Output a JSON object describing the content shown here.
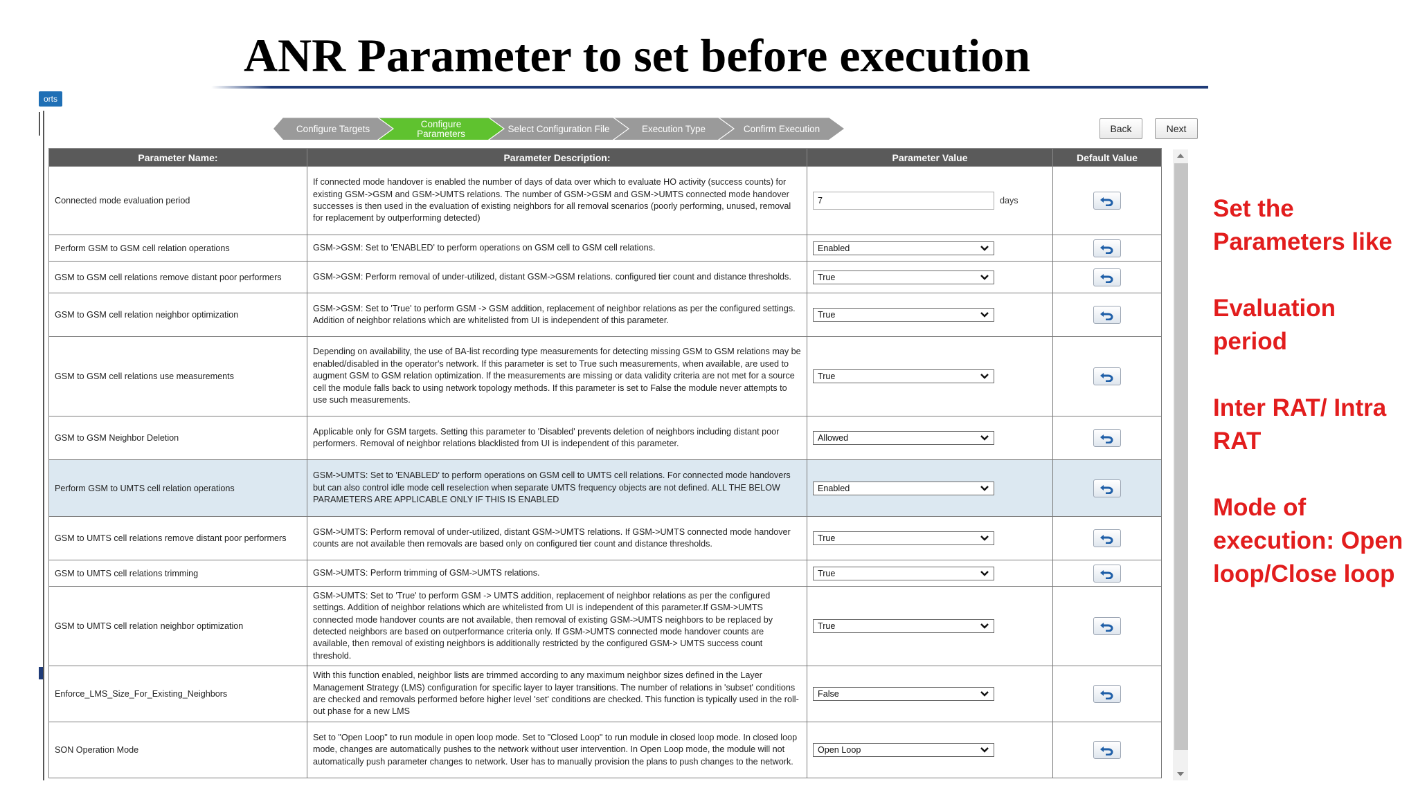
{
  "slide": {
    "title": "ANR Parameter to set before execution",
    "side_tab_label": "orts"
  },
  "wizard": {
    "steps": [
      {
        "label": "Configure Targets",
        "active": false
      },
      {
        "label": "Configure Parameters",
        "active": true
      },
      {
        "label": "Select Configuration File",
        "active": false
      },
      {
        "label": "Execution Type",
        "active": false
      },
      {
        "label": "Confirm Execution",
        "active": false
      }
    ],
    "back_label": "Back",
    "next_label": "Next"
  },
  "table": {
    "headers": [
      "Parameter Name:",
      "Parameter Description:",
      "Parameter Value",
      "Default Value"
    ],
    "rows": [
      {
        "name": "Connected mode evaluation period",
        "desc": "If connected mode handover is enabled the number of days of data over which to evaluate HO activity (success counts) for existing GSM->GSM and GSM->UMTS relations. The number of GSM->GSM and GSM->UMTS connected mode handover successes is then used in the evaluation of existing neighbors for all removal scenarios (poorly performing, unused, removal for replacement by outperforming detected)",
        "value": "7",
        "unit": "days",
        "control": "input"
      },
      {
        "name": "Perform GSM to GSM cell relation operations",
        "desc": "GSM->GSM: Set to 'ENABLED' to perform operations on GSM cell to GSM cell relations.",
        "value": "Enabled",
        "control": "select"
      },
      {
        "name": "GSM to GSM cell relations remove distant poor performers",
        "desc": "GSM->GSM: Perform removal of under-utilized, distant GSM->GSM relations. configured tier count and distance thresholds.",
        "value": "True",
        "control": "select"
      },
      {
        "name": "GSM to GSM cell relation neighbor optimization",
        "desc": "GSM->GSM: Set to 'True' to perform GSM -> GSM addition, replacement of neighbor relations as per the configured settings. Addition of neighbor relations which are whitelisted from UI is independent of this parameter.",
        "value": "True",
        "control": "select"
      },
      {
        "name": "GSM to GSM cell relations use measurements",
        "desc": "Depending on availability, the use of BA-list recording type measurements for detecting missing GSM to GSM relations may be enabled/disabled in the operator's network. If this parameter is set to True such measurements, when available, are used to augment GSM to GSM relation optimization. If the measurements are missing or data validity criteria are not met for a source cell the module falls back to using network topology methods. If this parameter is set to False the module never attempts to use such measurements.",
        "value": "True",
        "control": "select"
      },
      {
        "name": "GSM to GSM Neighbor Deletion",
        "desc": "Applicable only for GSM targets. Setting this parameter to 'Disabled' prevents deletion of neighbors including distant poor performers. Removal of neighbor relations blacklisted from UI is independent of this parameter.",
        "value": "Allowed",
        "control": "select"
      },
      {
        "name": "Perform GSM to UMTS cell relation operations",
        "desc": "GSM->UMTS: Set to 'ENABLED' to perform operations on GSM cell to UMTS cell relations. For connected mode handovers but can also control idle mode cell reselection when separate UMTS frequency objects are not defined. ALL THE BELOW PARAMETERS ARE APPLICABLE ONLY IF THIS IS ENABLED",
        "value": "Enabled",
        "control": "select",
        "highlight": true
      },
      {
        "name": "GSM to UMTS cell relations remove distant poor performers",
        "desc": "GSM->UMTS: Perform removal of under-utilized, distant GSM->UMTS relations. If GSM->UMTS connected mode handover counts are not available then removals are based only on configured tier count and distance thresholds.",
        "value": "True",
        "control": "select"
      },
      {
        "name": "GSM to UMTS cell relations trimming",
        "desc": "GSM->UMTS: Perform trimming of GSM->UMTS relations.",
        "value": "True",
        "control": "select"
      },
      {
        "name": "GSM to UMTS cell relation neighbor optimization",
        "desc": "GSM->UMTS: Set to 'True' to perform GSM -> UMTS addition, replacement of neighbor relations as per the configured settings. Addition of neighbor relations which are whitelisted from UI is independent of this parameter.If GSM->UMTS connected mode handover counts are not available, then removal of existing GSM->UMTS neighbors to be replaced by detected neighbors are based on outperformance criteria only. If GSM->UMTS connected mode handover counts are available, then removal of existing neighbors is additionally restricted by the configured GSM-> UMTS success count threshold.",
        "value": "True",
        "control": "select"
      },
      {
        "name": "Enforce_LMS_Size_For_Existing_Neighbors",
        "desc": "With this function enabled, neighbor lists are trimmed according to any maximum neighbor sizes defined in the Layer Management Strategy (LMS) configuration for specific layer to layer transitions. The number of relations in 'subset' conditions are checked and removals performed before higher level 'set' conditions are checked. This function is typically used in the roll-out phase for a new LMS",
        "value": "False",
        "control": "select"
      },
      {
        "name": "SON Operation Mode",
        "desc": "Set to \"Open Loop\" to run module in open loop mode. Set to \"Closed Loop\" to run module in closed loop mode. In closed loop mode, changes are automatically pushes to the network without user intervention. In Open Loop mode, the module will not automatically push parameter changes to network. User has to manually provision the plans to push changes to the network.",
        "value": "Open Loop",
        "control": "select"
      }
    ]
  },
  "annotations": {
    "note1": "Set the Parameters like",
    "note2": "Evaluation period",
    "note3": "Inter RAT/ Intra RAT",
    "note4": "Mode of execution: Open loop/Close loop"
  },
  "colors": {
    "active_step": "#5fc22f",
    "inactive_step": "#9a9a9a",
    "header_bg": "#5a5a5a",
    "highlight_row": "#dce8f1",
    "annotation": "#e21d1d",
    "title_rule": "#1f3b78"
  },
  "icons": {
    "default_value_button": "undo-arrow-icon",
    "select_arrow": "chevron-down-icon"
  }
}
